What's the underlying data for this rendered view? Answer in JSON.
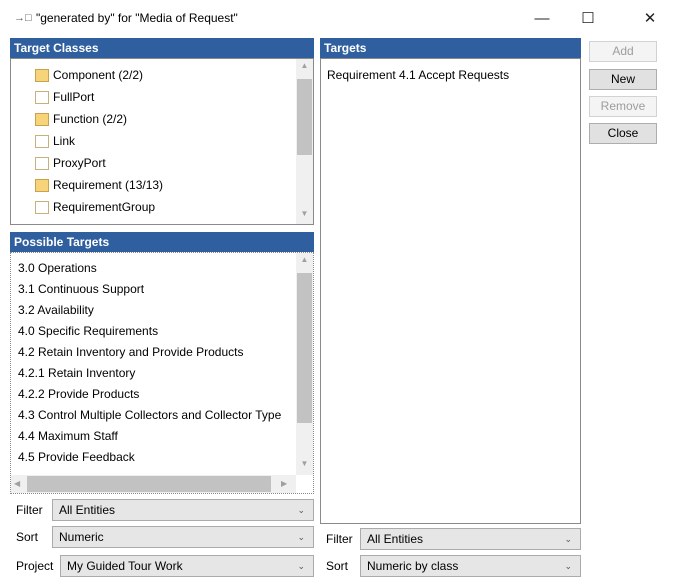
{
  "window": {
    "title_icon": "→□",
    "title": "\"generated by\" for \"Media of Request\"",
    "minimize": "—",
    "maximize": "☐",
    "close": "✕"
  },
  "target_classes": {
    "header": "Target Classes",
    "items": [
      {
        "label": "Component  (2/2)",
        "icon": "folder-filled-icon"
      },
      {
        "label": "FullPort",
        "icon": "folder-empty-icon"
      },
      {
        "label": "Function  (2/2)",
        "icon": "folder-filled-icon"
      },
      {
        "label": "Link",
        "icon": "folder-empty-icon"
      },
      {
        "label": "ProxyPort",
        "icon": "folder-empty-icon"
      },
      {
        "label": "Requirement  (13/13)",
        "icon": "folder-filled-icon"
      },
      {
        "label": "RequirementGroup",
        "icon": "folder-empty-icon"
      }
    ]
  },
  "possible_targets": {
    "header": "Possible Targets",
    "items": [
      "3.0 Operations",
      "3.1 Continuous Support",
      "3.2 Availability",
      "4.0 Specific Requirements",
      "4.2 Retain Inventory and Provide Products",
      "4.2.1 Retain Inventory",
      "4.2.2 Provide Products",
      "4.3 Control Multiple Collectors and Collector Type",
      "4.4 Maximum Staff",
      "4.5 Provide Feedback"
    ]
  },
  "targets": {
    "header": "Targets",
    "items": [
      "Requirement 4.1 Accept Requests"
    ]
  },
  "buttons": {
    "add": "Add",
    "new": "New",
    "remove": "Remove",
    "close": "Close"
  },
  "left_controls": {
    "filter_label": "Filter",
    "filter_value": "All Entities",
    "sort_label": "Sort",
    "sort_value": "Numeric",
    "project_label": "Project",
    "project_value": "My Guided Tour Work"
  },
  "right_controls": {
    "filter_label": "Filter",
    "filter_value": "All Entities",
    "sort_label": "Sort",
    "sort_value": "Numeric by class"
  },
  "glyphs": {
    "up": "▲",
    "down": "▼",
    "left": "◀",
    "right": "▶",
    "chevron": "⌄"
  }
}
